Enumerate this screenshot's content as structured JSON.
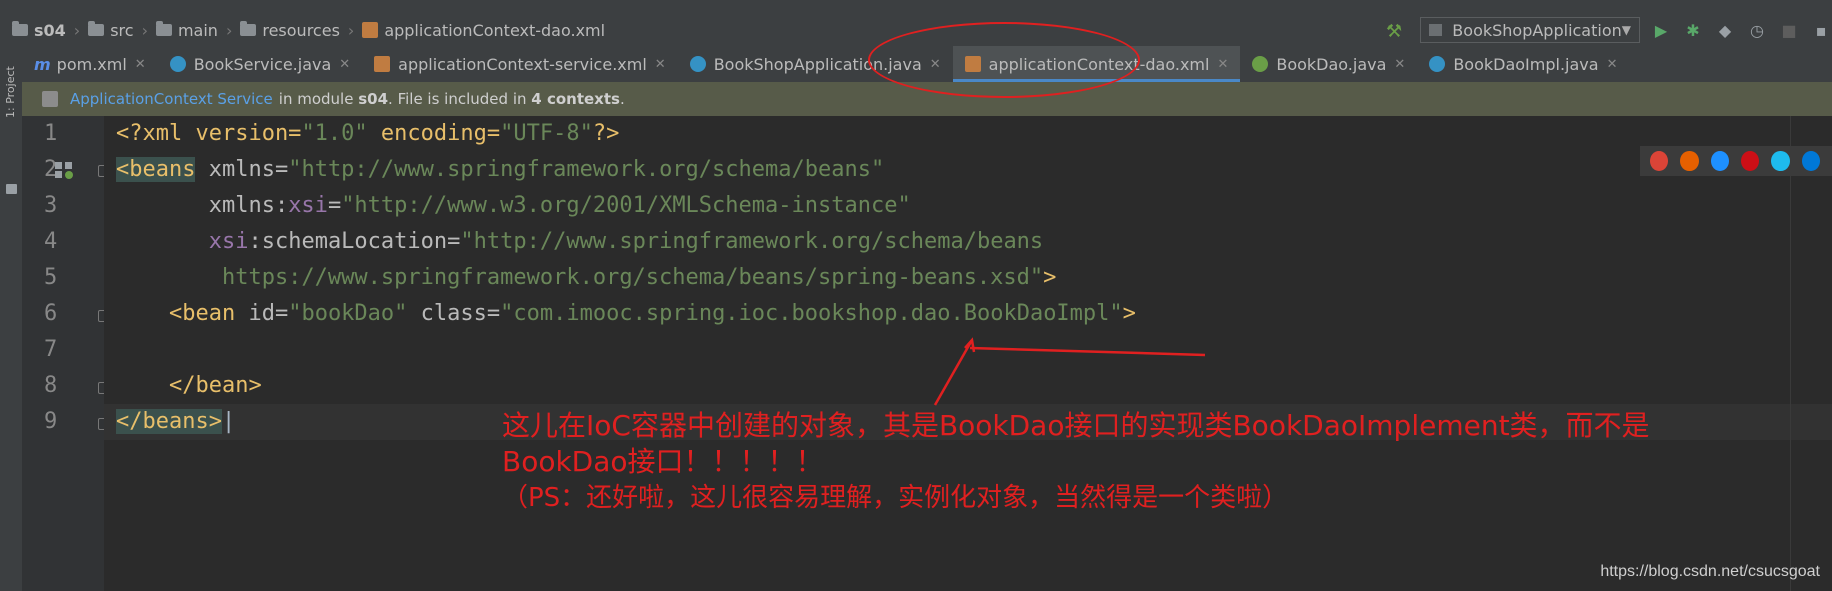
{
  "breadcrumb": [
    "s04",
    "src",
    "main",
    "resources",
    "applicationContext-dao.xml"
  ],
  "run_config": "BookShopApplication",
  "sidebar_label": "1: Project",
  "tabs": [
    {
      "label": "pom.xml",
      "icon": "maven-icon",
      "color": "#5a8ee6",
      "active": false
    },
    {
      "label": "BookService.java",
      "icon": "class-icon",
      "color": "#3592c4",
      "active": false
    },
    {
      "label": "applicationContext-service.xml",
      "icon": "spring-xml-icon",
      "color": "#c07c41",
      "active": false
    },
    {
      "label": "BookShopApplication.java",
      "icon": "class-icon",
      "color": "#3592c4",
      "active": false
    },
    {
      "label": "applicationContext-dao.xml",
      "icon": "spring-xml-icon",
      "color": "#c07c41",
      "active": true
    },
    {
      "label": "BookDao.java",
      "icon": "interface-icon",
      "color": "#6a9e47",
      "active": false
    },
    {
      "label": "BookDaoImpl.java",
      "icon": "class-icon",
      "color": "#3592c4",
      "active": false
    }
  ],
  "infobar": {
    "link": "ApplicationContext Service",
    "text1": "in module",
    "module": "s04",
    "text2": ". File is included in",
    "count": "4 contexts",
    "text3": "."
  },
  "code_lines": [
    {
      "num": "1",
      "html": "line1"
    },
    {
      "num": "2"
    },
    {
      "num": "3"
    },
    {
      "num": "4"
    },
    {
      "num": "5"
    },
    {
      "num": "6"
    },
    {
      "num": "7"
    },
    {
      "num": "8"
    },
    {
      "num": "9"
    }
  ],
  "code": {
    "l1a": "<?xml version=",
    "l1b": "\"1.0\"",
    "l1c": " encoding=",
    "l1d": "\"UTF-8\"",
    "l1e": "?>",
    "l2a": "<beans",
    "l2b": " xmlns=",
    "l2c": "\"http://www.springframework.org/schema/beans\"",
    "l3a": "       xmlns:",
    "l3b": "xsi",
    "l3c": "=",
    "l3d": "\"http://www.w3.org/2001/XMLSchema-instance\"",
    "l4a": "       ",
    "l4b": "xsi",
    "l4c": ":schemaLocation=",
    "l4d": "\"http://www.springframework.org/schema/beans",
    "l5a": "        https://www.springframework.org/schema/beans/spring-beans.xsd\"",
    "l5b": ">",
    "l6a": "    <bean",
    "l6b": " id=",
    "l6c": "\"bookDao\"",
    "l6d": " class=",
    "l6e": "\"com.imooc.spring.ioc.bookshop.dao.BookDaoImpl\"",
    "l6f": ">",
    "l8a": "    </bean>",
    "l9a": "</beans>"
  },
  "annotation": {
    "line1": "这儿在IoC容器中创建的对象，其是BookDao接口的实现类BookDaoImplement类，而不是",
    "line2": "BookDao接口！！！！！",
    "line3": "（PS：还好啦，这儿很容易理解，实例化对象，当然得是一个类啦）"
  },
  "credit": "https://blog.csdn.net/csucsgoat",
  "browser_icons": [
    {
      "name": "chrome-icon",
      "color": "#db4437"
    },
    {
      "name": "firefox-icon",
      "color": "#e66000"
    },
    {
      "name": "safari-icon",
      "color": "#1e90ff"
    },
    {
      "name": "opera-icon",
      "color": "#cc0f16"
    },
    {
      "name": "ie-icon",
      "color": "#1ebbee"
    },
    {
      "name": "edge-icon",
      "color": "#0078d7"
    }
  ]
}
